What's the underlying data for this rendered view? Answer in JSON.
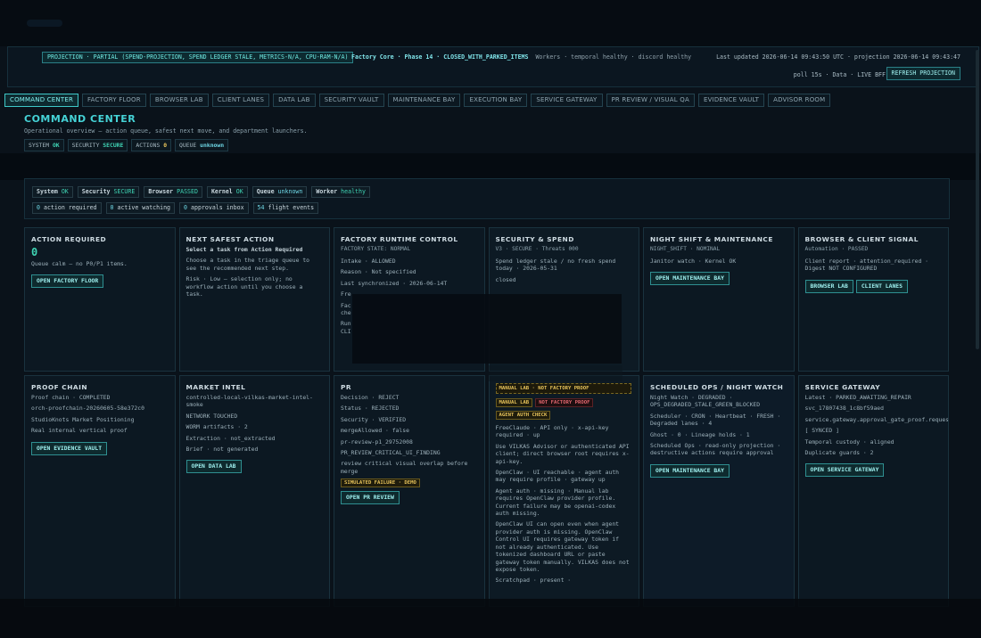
{
  "statusbar": {
    "projection": "PROJECTION · PARTIAL (SPEND-PROJECTION, SPEND LEDGER STALE, METRICS-N/A, CPU-RAM-N/A)",
    "factory_core": "Factory Core · Phase 14 · CLOSED_WITH_PARKED_ITEMS",
    "workers": "Workers · temporal healthy · discord healthy",
    "last_updated": "Last updated 2026-06-14 09:43:50 UTC · projection 2026-06-14 09:43:47",
    "poll": "poll 15s · Data · LIVE BFF",
    "refresh_label": "REFRESH PROJECTION"
  },
  "tabs": [
    {
      "label": "COMMAND CENTER",
      "active": true
    },
    {
      "label": "FACTORY FLOOR"
    },
    {
      "label": "BROWSER LAB"
    },
    {
      "label": "CLIENT LANES"
    },
    {
      "label": "DATA LAB"
    },
    {
      "label": "SECURITY VAULT"
    },
    {
      "label": "MAINTENANCE BAY"
    },
    {
      "label": "EXECUTION BAY"
    },
    {
      "label": "SERVICE GATEWAY"
    },
    {
      "label": "PR REVIEW / VISUAL QA"
    },
    {
      "label": "EVIDENCE VAULT"
    },
    {
      "label": "ADVISOR ROOM"
    }
  ],
  "page": {
    "title": "COMMAND CENTER",
    "subtitle": "Operational overview — action queue, safest next move, and department launchers.",
    "chips": {
      "system_label": "SYSTEM",
      "system_value": "OK",
      "security_label": "SECURITY",
      "security_value": "SECURE",
      "actions_label": "ACTIONS",
      "actions_value": "0",
      "queue_label": "QUEUE",
      "queue_value": "unknown"
    }
  },
  "overview": {
    "system_label": "System",
    "system_value": "OK",
    "security_label": "Security",
    "security_value": "SECURE",
    "browser_label": "Browser",
    "browser_value": "PASSED",
    "kernel_label": "Kernel",
    "kernel_value": "OK",
    "queue_label": "Queue",
    "queue_value": "unknown",
    "worker_label": "Worker",
    "worker_value": "healthy",
    "action_required_count": "0",
    "action_required_label": "action required",
    "active_watching_count": "0",
    "active_watching_label": "active watching",
    "approvals_count": "0",
    "approvals_label": "approvals inbox",
    "flight_count": "54",
    "flight_label": "flight events"
  },
  "cards": {
    "action_required": {
      "title": "ACTION REQUIRED",
      "count": "0",
      "text": "Queue calm — no P0/P1 items.",
      "button": "OPEN FACTORY FLOOR"
    },
    "next_safe": {
      "title": "NEXT SAFEST ACTION",
      "line1": "Select a task from Action Required",
      "line2": "Choose a task in the triage queue to see the recommended next step.",
      "line3": "Risk · Low — selection only; no workflow action until you choose a task."
    },
    "factory_runtime": {
      "title": "FACTORY RUNTIME CONTROL",
      "state": "FACTORY STATE: NORMAL",
      "intake": "Intake · ALLOWED",
      "reason": "Reason · Not specified",
      "last_sync": "Last synchronized · 2026-06-14T",
      "fre": "Fre",
      "fac": "Fac",
      "che": "che",
      "run": "Run",
      "cli": "CLI"
    },
    "security_spend": {
      "title": "SECURITY & SPEND",
      "sub": "V3 · SECURE · Threats 000",
      "line1": "Spend ledger stale / no fresh spend today · 2026-05-31",
      "line2": "closed"
    },
    "night_shift": {
      "title": "NIGHT SHIFT & MAINTENANCE",
      "sub": "NIGHT_SHIFT · NOMINAL",
      "line1": "Janitor watch · Kernel OK",
      "button": "OPEN MAINTENANCE BAY"
    },
    "browser_client": {
      "title": "BROWSER & CLIENT SIGNAL",
      "sub": "Automation · PASSED",
      "line1": "Client report · attention_required · Digest NOT CONFIGURED",
      "button1": "BROWSER LAB",
      "button2": "CLIENT LANES"
    },
    "proof_chain": {
      "title": "PROOF CHAIN",
      "line1": "Proof chain · COMPLETED",
      "line2": "orch-proofchain-20260605-58e372c0",
      "line3": "StudioKnots Market Positioning",
      "line4": "Real internal vertical proof",
      "button": "OPEN EVIDENCE VAULT"
    },
    "market_intel": {
      "title": "MARKET INTEL",
      "line1": "controlled-local-vilkas-market-intel-smoke",
      "line2": "NETWORK TOUCHED",
      "line3": "WORM artifacts · 2",
      "line4": "Extraction · not_extracted",
      "line5": "Brief · not generated",
      "button": "OPEN DATA LAB"
    },
    "pr": {
      "title": "PR",
      "line1": "Decision · REJECT",
      "line2": "Status · REJECTED",
      "line3": "Security · VERIFIED",
      "line4": "mergeAllowed · false",
      "line5": "pr-review-p1_29752008",
      "line6": "PR_REVIEW_CRITICAL_UI_FINDING",
      "line7": "review critical visual overlap before merge",
      "badge": "SIMULATED FAILURE · DEMO",
      "button": "OPEN PR REVIEW"
    },
    "manual_lab": {
      "banner": "MANUAL LAB · NOT FACTORY PROOF",
      "badge1": "MANUAL LAB",
      "badge2": "NOT FACTORY PROOF",
      "badge3": "AGENT AUTH CHECK",
      "line1": "FreeClaude · API only · x-api-key required · up",
      "line2": "Use VILKAS Advisor or authenticated API client; direct browser root requires x-api-key.",
      "line3": "OpenClaw · UI reachable · agent auth may require profile · gateway up",
      "line4": "Agent auth · missing · Manual lab requires OpenClaw provider profile. Current failure may be openai-codex auth missing.",
      "line5": "OpenClaw UI can open even when agent provider auth is missing. OpenClaw Control UI requires gateway token if not already authenticated. Use tokenized dashboard URL or paste gateway token manually. VILKAS does not expose token.",
      "line6": "Scratchpad · present ·"
    },
    "scheduled_ops": {
      "title": "SCHEDULED OPS / NIGHT WATCH",
      "line1": "Night Watch · DEGRADED · OPS_DEGRADED_STALE_GREEN_BLOCKED",
      "line2": "Scheduler · CRON · Heartbeat · FRESH · Degraded lanes · 4",
      "line3": "Ghost · 0 · Lineage holds · 1",
      "line4": "Scheduled Ops · read-only projection · destructive actions require approval",
      "button": "OPEN MAINTENANCE BAY"
    },
    "service_gateway": {
      "title": "SERVICE GATEWAY",
      "line1": "Latest · PARKED_AWAITING_REPAIR",
      "line2": "svc_17807438_1c8bf59aed",
      "line3": "service.gateway.approval_gate_proof.request",
      "line4": "[ SYNCED ]",
      "line5": "Temporal custody · aligned",
      "line6": "Duplicate guards · 2",
      "button": "OPEN SERVICE GATEWAY"
    }
  }
}
